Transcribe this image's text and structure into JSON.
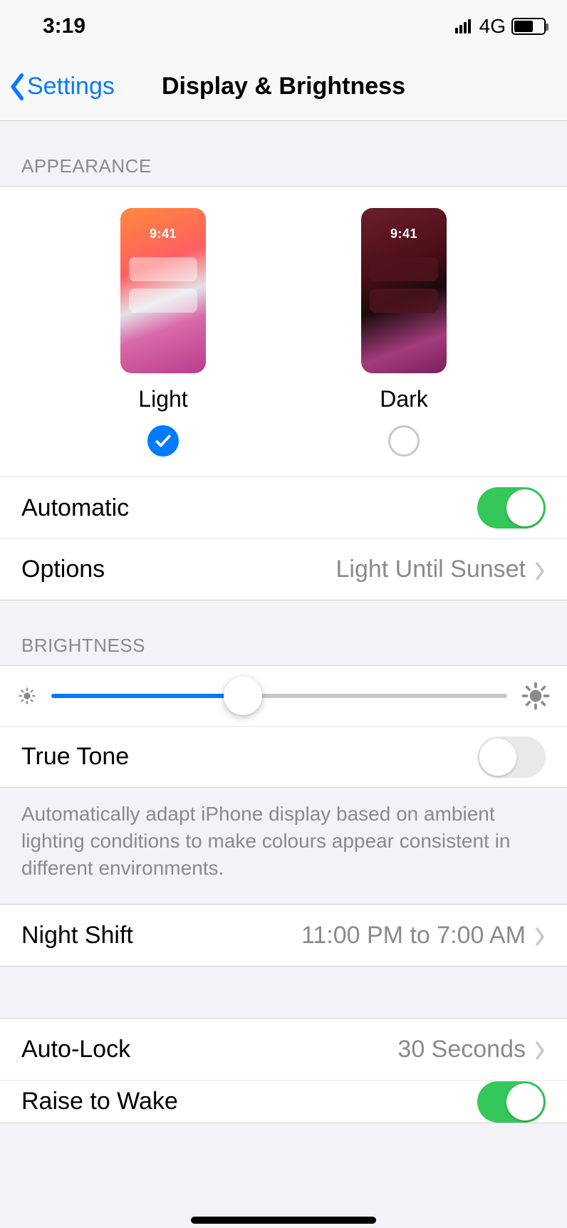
{
  "status": {
    "time": "3:19",
    "network": "4G"
  },
  "nav": {
    "back": "Settings",
    "title": "Display & Brightness"
  },
  "appearance": {
    "header": "APPEARANCE",
    "preview_time": "9:41",
    "light_label": "Light",
    "dark_label": "Dark",
    "automatic_label": "Automatic",
    "automatic_on": true,
    "options_label": "Options",
    "options_value": "Light Until Sunset"
  },
  "brightness": {
    "header": "BRIGHTNESS",
    "value_percent": 42,
    "true_tone_label": "True Tone",
    "true_tone_on": false,
    "true_tone_desc": "Automatically adapt iPhone display based on ambient lighting conditions to make colours appear consistent in different environments."
  },
  "night_shift": {
    "label": "Night Shift",
    "value": "11:00 PM to 7:00 AM"
  },
  "auto_lock": {
    "label": "Auto-Lock",
    "value": "30 Seconds"
  },
  "raise_to_wake": {
    "label": "Raise to Wake",
    "on": true
  }
}
